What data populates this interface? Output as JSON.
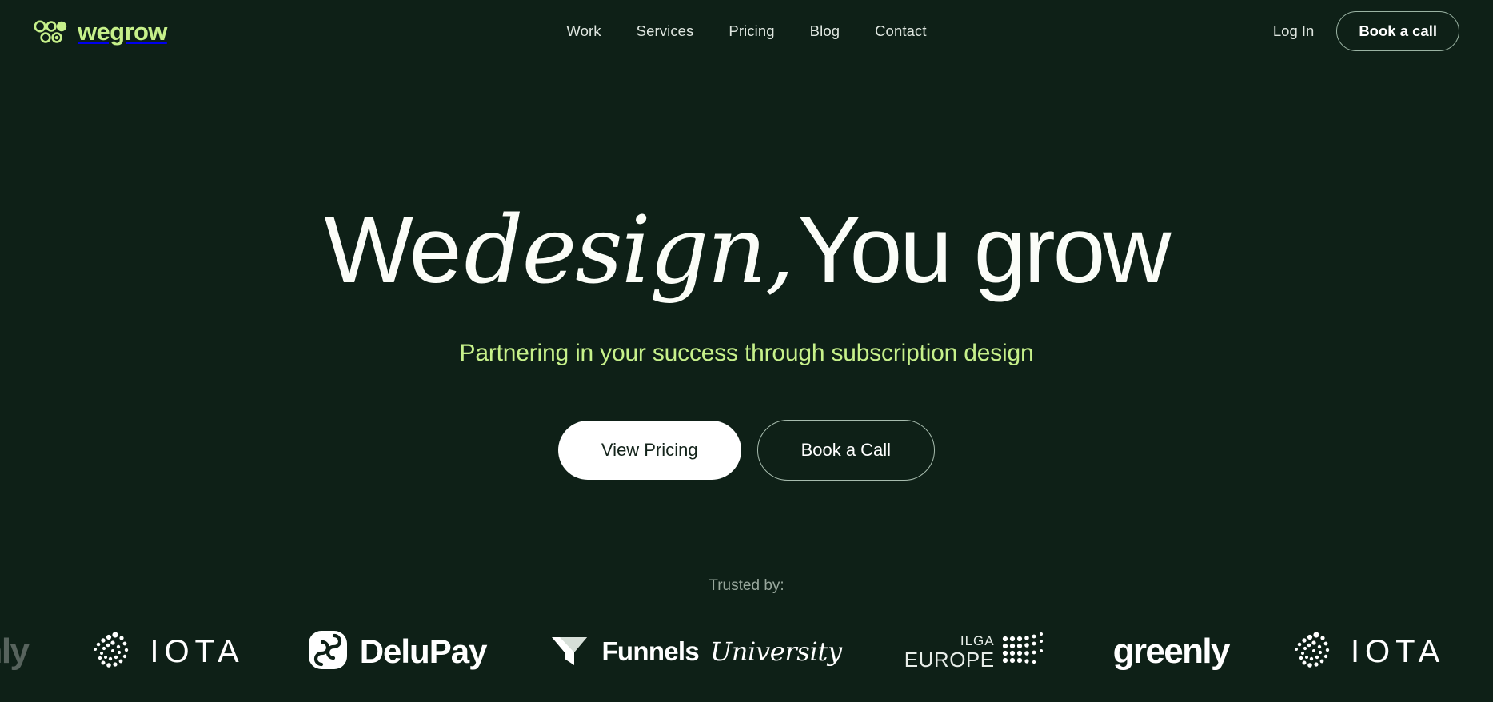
{
  "brand": {
    "name": "wegrow",
    "mark": "wegrow-dots-logo",
    "color": "#c6f08a"
  },
  "nav": {
    "links": [
      {
        "label": "Work"
      },
      {
        "label": "Services"
      },
      {
        "label": "Pricing"
      },
      {
        "label": "Blog"
      },
      {
        "label": "Contact"
      }
    ],
    "login_label": "Log In",
    "cta_label": "Book a call"
  },
  "hero": {
    "headline_part1": "We",
    "headline_accent": "design,",
    "headline_part2": "You grow",
    "subheadline": "Partnering in your success through subscription design",
    "primary_cta": "View Pricing",
    "secondary_cta": "Book a Call"
  },
  "trusted": {
    "label": "Trusted by:",
    "logos": [
      {
        "name": "greenly",
        "type": "wordmark",
        "dim": true
      },
      {
        "name": "IOTA",
        "type": "iota",
        "dim": false
      },
      {
        "name": "DeluPay",
        "type": "delupay",
        "dim": false
      },
      {
        "name": "Funnels University",
        "type": "funnels",
        "word1": "Funnels",
        "word2": "University",
        "dim": false
      },
      {
        "name": "ILGA EUROPE",
        "type": "ilga",
        "line1": "ILGA",
        "line2": "EUROPE",
        "dim": false
      },
      {
        "name": "greenly",
        "type": "wordmark",
        "dim": false
      },
      {
        "name": "IOTA",
        "type": "iota",
        "dim": false
      },
      {
        "name": "DeluPay",
        "type": "delupay-mark-only",
        "dim": true
      }
    ]
  },
  "colors": {
    "background": "#0e2017",
    "accent_green": "#c6f08a",
    "text_white": "#fbfdf8",
    "text_muted": "#98a79c"
  }
}
